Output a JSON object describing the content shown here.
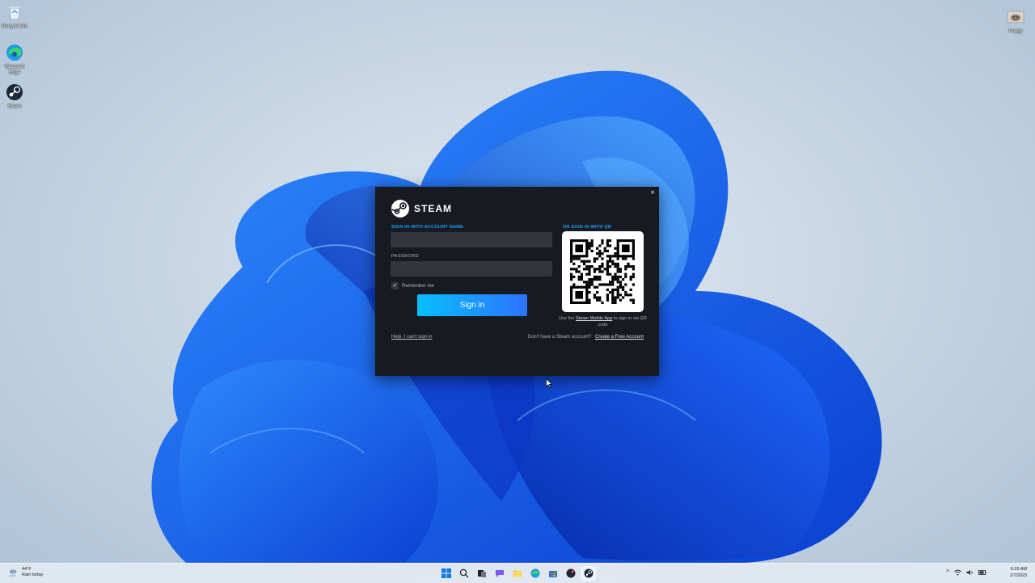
{
  "desktop": {
    "icons": [
      {
        "label": "Recycle Bin"
      },
      {
        "label": "Microsoft Edge"
      },
      {
        "label": "Steam"
      },
      {
        "label": "Puppy"
      }
    ]
  },
  "steam_login": {
    "logo_text": "STEAM",
    "account_section_label": "SIGN IN WITH ACCOUNT NAME",
    "account_value": "",
    "password_label": "PASSWORD",
    "password_value": "",
    "remember_me": {
      "label": "Remember me",
      "checked": true
    },
    "signin_button": "Sign in",
    "help_link": "Help, I can't sign in",
    "qr_section_label": "OR SIGN IN WITH QR",
    "qr_caption_pre": "Use the",
    "qr_caption_link": "Steam Mobile App",
    "qr_caption_post": "to sign in via QR code",
    "no_account_text": "Don't have a Steam account?",
    "create_account_link": "Create a Free Account",
    "close_glyph": "×",
    "accent_color": "#1a9fff",
    "bg_color": "#181a21"
  },
  "taskbar": {
    "weather_temp": "44°F",
    "weather_desc": "Rain today",
    "pinned": [
      "start-icon",
      "search-icon",
      "task-view-icon",
      "chat-icon",
      "file-explorer-icon",
      "edge-icon",
      "store-icon",
      "app-icon",
      "steam-icon"
    ],
    "tray_chevron": "^",
    "time": "6:26 AM",
    "date": "1/7/2023"
  }
}
